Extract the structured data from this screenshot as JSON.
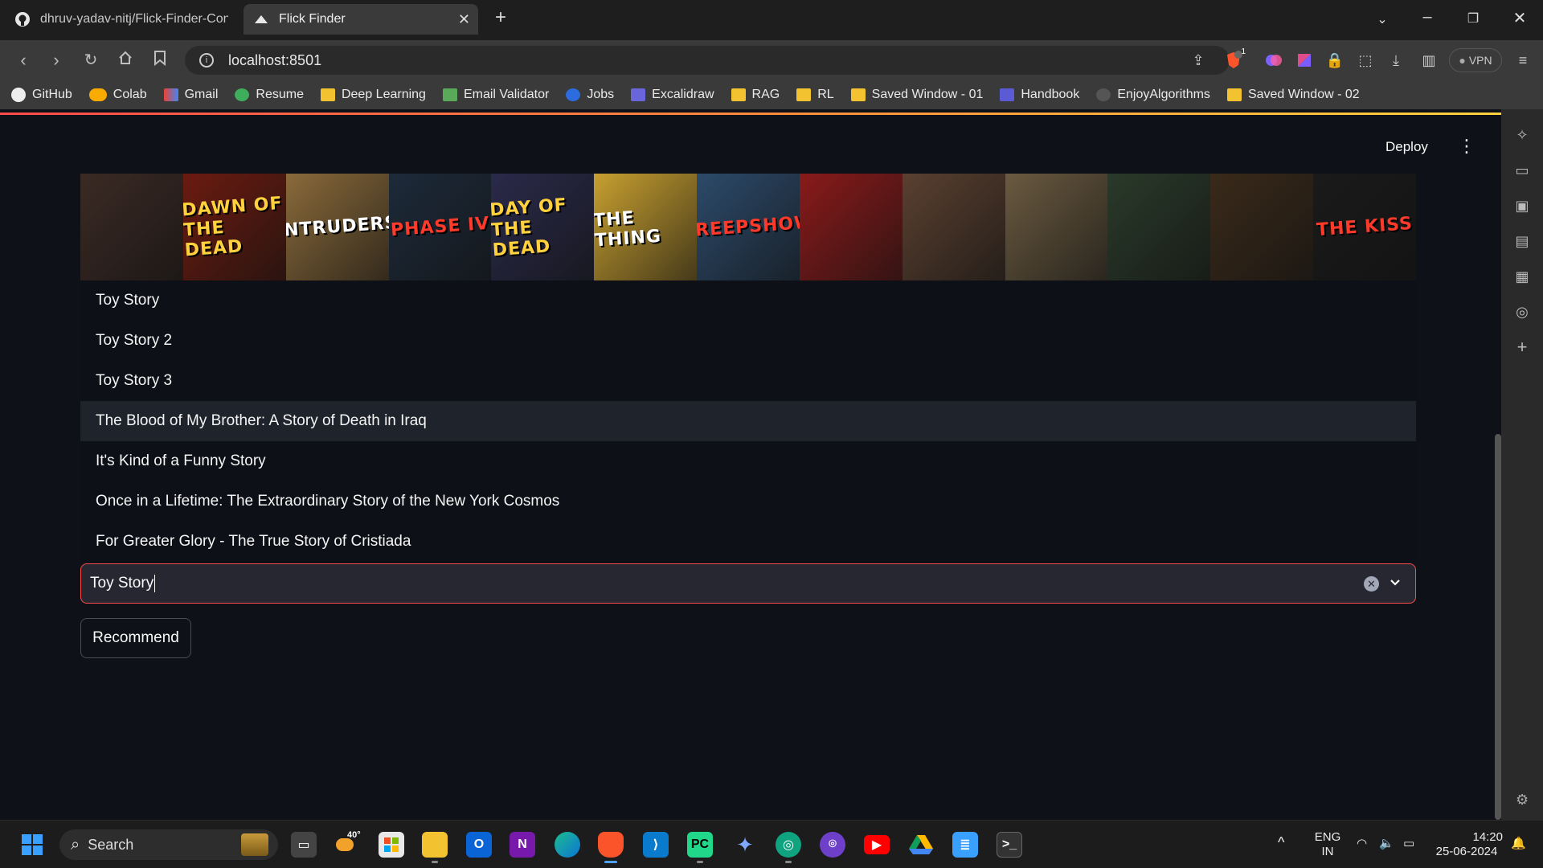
{
  "browser": {
    "tabs": [
      {
        "title": "dhruv-yadav-nitj/Flick-Finder-Conte",
        "icon": "github-icon",
        "active": false
      },
      {
        "title": "Flick Finder",
        "icon": "streamlit-icon",
        "active": true
      }
    ],
    "url": "localhost:8501",
    "vpn_label": "VPN",
    "brave_badge": "1",
    "bookmarks": [
      {
        "label": "GitHub",
        "icon": "github-icon"
      },
      {
        "label": "Colab",
        "icon": "colab-icon"
      },
      {
        "label": "Gmail",
        "icon": "gmail-icon"
      },
      {
        "label": "Resume",
        "icon": "resume-icon"
      },
      {
        "label": "Deep Learning",
        "icon": "folder-icon"
      },
      {
        "label": "Email Validator",
        "icon": "email-validator-icon"
      },
      {
        "label": "Jobs",
        "icon": "jobs-icon"
      },
      {
        "label": "Excalidraw",
        "icon": "excalidraw-icon"
      },
      {
        "label": "RAG",
        "icon": "folder-icon"
      },
      {
        "label": "RL",
        "icon": "folder-icon"
      },
      {
        "label": "Saved Window - 01",
        "icon": "folder-icon"
      },
      {
        "label": "Handbook",
        "icon": "handbook-icon"
      },
      {
        "label": "EnjoyAlgorithms",
        "icon": "enjoyalgorithms-icon"
      },
      {
        "label": "Saved Window - 02",
        "icon": "folder-icon"
      }
    ]
  },
  "app": {
    "deploy_label": "Deploy",
    "banner_posters": [
      "",
      "DAWN OF THE DEAD",
      "INTRUDERS",
      "PHASE IV",
      "DAY OF THE DEAD",
      "THE THING",
      "CREEPSHOW",
      "",
      "",
      "",
      "",
      "",
      "THE KISS"
    ],
    "dropdown_options": [
      "Toy Story",
      "Toy Story 2",
      "Toy Story 3",
      "The Blood of My Brother: A Story of Death in Iraq",
      "It's Kind of a Funny Story",
      "Once in a Lifetime: The Extraordinary Story of the New York Cosmos",
      "For Greater Glory - The True Story of Cristiada"
    ],
    "highlighted_option_index": 3,
    "select_value": "Toy Story",
    "recommend_label": "Recommend",
    "accent_color": "#ff4b4b"
  },
  "taskbar": {
    "search_placeholder": "Search",
    "weather": "40°",
    "apps": [
      "widgets-icon",
      "task-view-icon",
      "weather-icon",
      "store-icon",
      "file-explorer-icon",
      "outlook-icon",
      "onenote-icon",
      "edge-icon",
      "brave-icon",
      "vscode-icon",
      "pycharm-icon",
      "gemini-icon",
      "chatgpt-icon",
      "github-desktop-icon",
      "youtube-icon",
      "google-drive-icon",
      "notepad-icon",
      "terminal-icon"
    ],
    "language": "ENG",
    "region": "IN",
    "time": "14:20",
    "date": "25-06-2024"
  }
}
